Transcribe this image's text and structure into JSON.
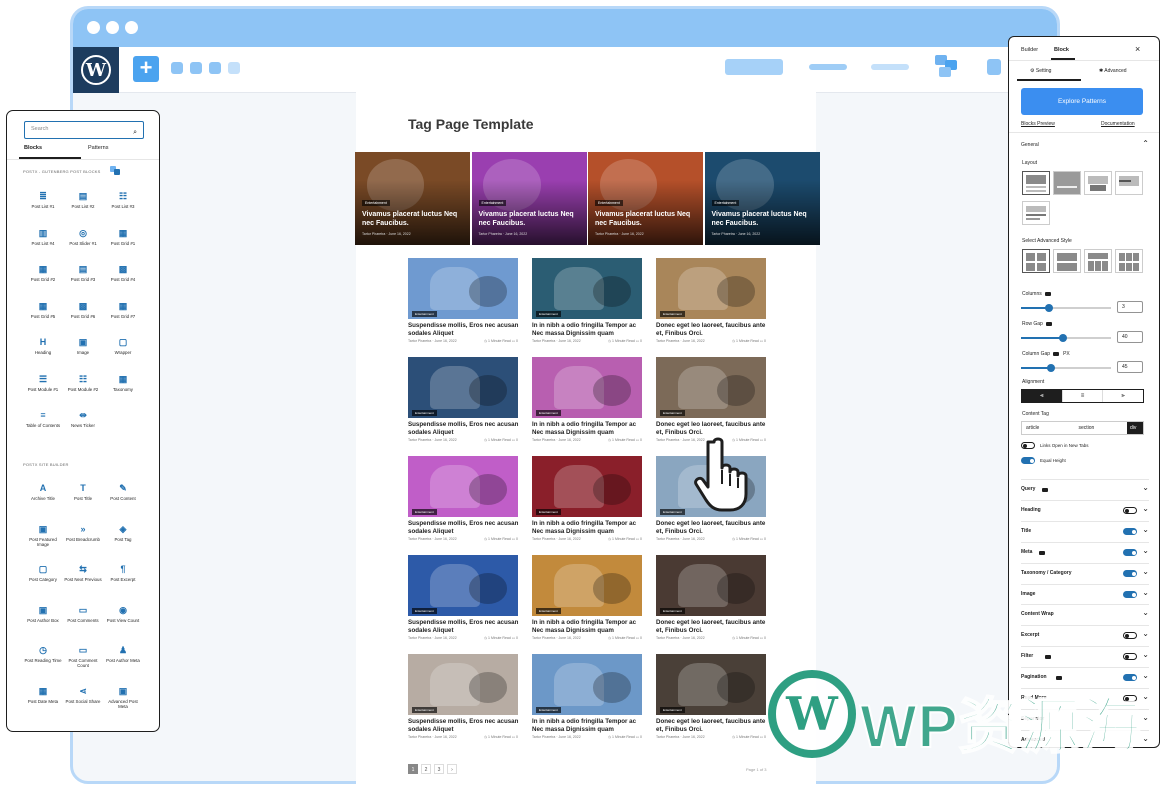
{
  "page": {
    "title": "Tag Page Template",
    "hero_category": "Entertainment",
    "hero_title": "Vivamus placerat luctus Neq nec Faucibus.",
    "hero_meta": "Tartor Pharetra · June 16, 2022",
    "hero_colors": [
      "#7a4a26",
      "#9a3fb0",
      "#b5502a",
      "#1c4b6e"
    ],
    "card_category": "Entertainment",
    "card_meta": "Tartor Pharetra · June 16, 2022",
    "card_stat": "◷ 1 Minute Read   ▭ 0",
    "col_titles": [
      "Suspendisse mollis, Eros nec acusan sodales Aliquet",
      "In in nibh a odio fringilla Tempor ac Nec massa Dignissim quam",
      "Donec eget leo laoreet, faucibus ante et, Finibus Orci."
    ],
    "card_colors": [
      [
        "#6f9ad0",
        "#2b5d73",
        "#a9865a"
      ],
      [
        "#2c4f78",
        "#b85fb0",
        "#7c6a58"
      ],
      [
        "#c05ec8",
        "#8a1f2a",
        "#8aa6c0"
      ],
      [
        "#2d5aa8",
        "#c28a3c",
        "#4a3a33"
      ],
      [
        "#b7aca3",
        "#6c98c8",
        "#4a4038"
      ]
    ],
    "pages": [
      "1",
      "2",
      "3",
      "›"
    ],
    "page_info": "Page 1 of 3"
  },
  "left_panel": {
    "search_placeholder": "Search",
    "tabs": [
      "Blocks",
      "Patterns"
    ],
    "section1": "POSTX - GUTENBERG POST BLOCKS",
    "section2": "POSTX SITE BUILDER",
    "blocks1": [
      {
        "label": "Post List #1",
        "icon": "≣"
      },
      {
        "label": "Post List #2",
        "icon": "▤"
      },
      {
        "label": "Post List #3",
        "icon": "☷"
      },
      {
        "label": "Post List #4",
        "icon": "▥"
      },
      {
        "label": "Post Slider #1",
        "icon": "◎"
      },
      {
        "label": "Post Grid #1",
        "icon": "▦"
      },
      {
        "label": "Post Grid #2",
        "icon": "▦"
      },
      {
        "label": "Post Grid #3",
        "icon": "▤"
      },
      {
        "label": "Post Grid #4",
        "icon": "▩"
      },
      {
        "label": "Post Grid #5",
        "icon": "▦"
      },
      {
        "label": "Post Grid #6",
        "icon": "▩"
      },
      {
        "label": "Post Grid #7",
        "icon": "▦"
      },
      {
        "label": "Heading",
        "icon": "H"
      },
      {
        "label": "Image",
        "icon": "▣"
      },
      {
        "label": "Wrapper",
        "icon": "▢"
      },
      {
        "label": "Post Module #1",
        "icon": "☰"
      },
      {
        "label": "Post Module #2",
        "icon": "☷"
      },
      {
        "label": "Taxonomy",
        "icon": "▦"
      },
      {
        "label": "Table of Contents",
        "icon": "≡"
      },
      {
        "label": "News Ticker",
        "icon": "⇹"
      }
    ],
    "blocks2": [
      {
        "label": "Archive Title",
        "icon": "A"
      },
      {
        "label": "Post Title",
        "icon": "T"
      },
      {
        "label": "Post Content",
        "icon": "✎"
      },
      {
        "label": "Post Featured Image",
        "icon": "▣"
      },
      {
        "label": "Post Breadcrumb",
        "icon": "»"
      },
      {
        "label": "Post Tag",
        "icon": "◈"
      },
      {
        "label": "Post Category",
        "icon": "▢"
      },
      {
        "label": "Post Next Previous",
        "icon": "⇆"
      },
      {
        "label": "Post Excerpt",
        "icon": "¶"
      },
      {
        "label": "Post Author Box",
        "icon": "▣"
      },
      {
        "label": "Post Comments",
        "icon": "▭"
      },
      {
        "label": "Post View Count",
        "icon": "◉"
      },
      {
        "label": "Post Reading Time",
        "icon": "◷"
      },
      {
        "label": "Post Comment Count",
        "icon": "▭"
      },
      {
        "label": "Post Author Meta",
        "icon": "♟"
      },
      {
        "label": "Post Date Meta",
        "icon": "▦"
      },
      {
        "label": "Post Social Share",
        "icon": "⋖"
      },
      {
        "label": "Advanced Post Meta",
        "icon": "▣"
      }
    ]
  },
  "right_panel": {
    "tabs": [
      "Builder",
      "Block"
    ],
    "close": "×",
    "subtabs": [
      "⚙ Setting",
      "✱ Advanced"
    ],
    "explore_button": "Explore Patterns",
    "blocks_preview": "Blocks Preview",
    "documentation": "Documentation",
    "general": "General",
    "layout_label": "Layout",
    "advanced_style_label": "Select Advanced Style",
    "columns_label": "Columns",
    "columns_value": "3",
    "row_gap_label": "Row Gap",
    "row_gap_value": "40",
    "column_gap_label": "Column Gap",
    "column_gap_unit": "PX",
    "column_gap_value": "45",
    "alignment_label": "Alignment",
    "alignment_options": [
      "⫷",
      "≡",
      "⫸"
    ],
    "content_tag_label": "Content Tag",
    "content_tags": [
      "article",
      "section",
      "div"
    ],
    "links_new_tab": "Links Open in New Tabs",
    "equal_height": "Equal Height",
    "sections": [
      {
        "label": "Query",
        "badge": true,
        "toggle": null
      },
      {
        "label": "Heading",
        "badge": false,
        "toggle": false
      },
      {
        "label": "Title",
        "badge": false,
        "toggle": true
      },
      {
        "label": "Meta",
        "badge": true,
        "toggle": true
      },
      {
        "label": "Taxonomy / Category",
        "badge": false,
        "toggle": true
      },
      {
        "label": "Image",
        "badge": false,
        "toggle": true
      },
      {
        "label": "Content Wrap",
        "badge": false,
        "toggle": null
      },
      {
        "label": "Excerpt",
        "badge": false,
        "toggle": false
      },
      {
        "label": "Filter",
        "badge": true,
        "toggle": false
      },
      {
        "label": "Pagination",
        "badge": true,
        "toggle": true
      },
      {
        "label": "Read More",
        "badge": false,
        "toggle": false
      },
      {
        "label": "Separator",
        "badge": false,
        "toggle": null
      },
      {
        "label": "Advanced",
        "badge": false,
        "toggle": null
      }
    ]
  },
  "watermark": {
    "logo": "W",
    "text": "WP资源海"
  },
  "colors": {
    "accent": "#2271b1",
    "frame": "#8ec4f5",
    "watermark": "#2e9f82"
  },
  "icons": {
    "wordpress": "wordpress-logo-icon",
    "add": "plus-icon",
    "search": "search-icon",
    "hand": "hand-pointer-icon"
  }
}
